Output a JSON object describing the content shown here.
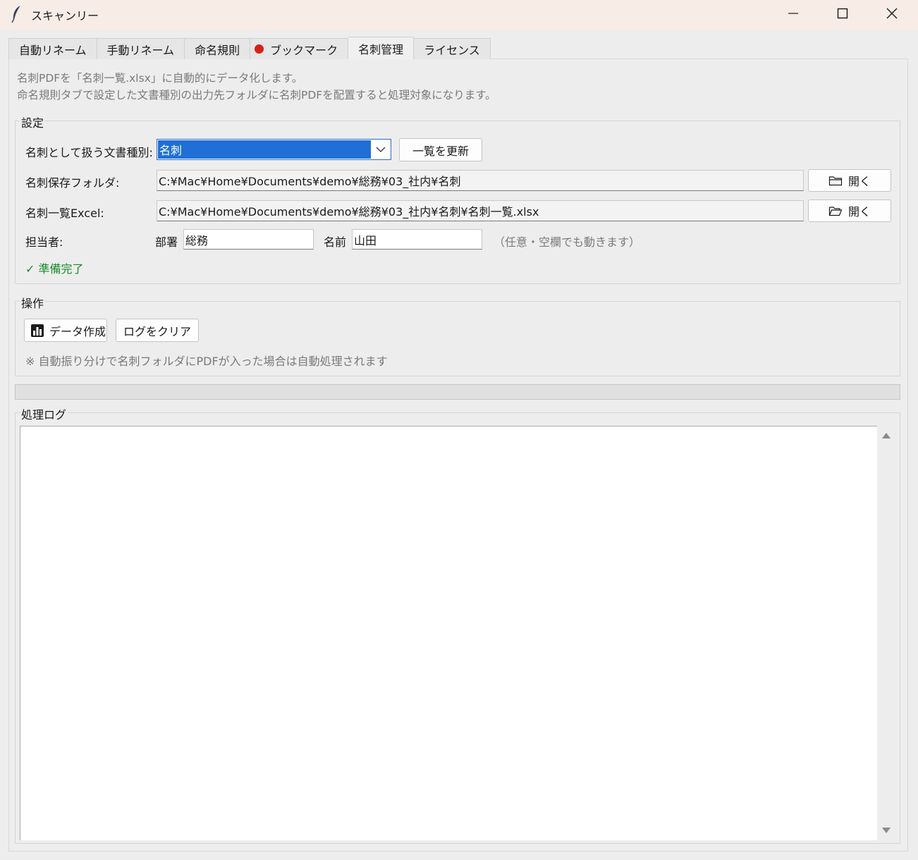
{
  "window": {
    "title": "スキャンリー",
    "controls": [
      "minimize",
      "maximize",
      "close"
    ]
  },
  "tabs": [
    {
      "label": "自動リネーム",
      "active": false
    },
    {
      "label": "手動リネーム",
      "active": false
    },
    {
      "label": "命名規則",
      "active": false
    },
    {
      "label": "ブックマーク",
      "active": false,
      "dot_color": "#d8201a"
    },
    {
      "label": "名刺管理",
      "active": true
    },
    {
      "label": "ライセンス",
      "active": false
    }
  ],
  "description": {
    "line1": "名刺PDFを「名刺一覧.xlsx」に自動的にデータ化します。",
    "line2": "命名規則タブで設定した文書種別の出力先フォルダに名刺PDFを配置すると処理対象になります。"
  },
  "settings": {
    "group_label": "設定",
    "doc_type_label": "名刺として扱う文書種別:",
    "doc_type_value": "名刺",
    "refresh_button": "一覧を更新",
    "folder_label": "名刺保存フォルダ:",
    "folder_value": "C:¥Mac¥Home¥Documents¥demo¥総務¥03_社内¥名刺",
    "excel_label": "名刺一覧Excel:",
    "excel_value": "C:¥Mac¥Home¥Documents¥demo¥総務¥03_社内¥名刺¥名刺一覧.xlsx",
    "open_button": "開く",
    "person_label": "担当者:",
    "dept_label": "部署",
    "dept_value": "総務",
    "name_label": "名前",
    "name_value": "山田",
    "optional_note": "（任意・空欄でも動きます）",
    "status_text": "✓ 準備完了",
    "status_color": "#1a8a2a"
  },
  "operations": {
    "group_label": "操作",
    "create_button": "データ作成",
    "clear_button": "ログをクリア",
    "note": "※ 自動振り分けで名刺フォルダにPDFが入った場合は自動処理されます"
  },
  "log": {
    "group_label": "処理ログ",
    "content": ""
  },
  "colors": {
    "accent": "#1f6fd6",
    "titlebar": "#f7ece6",
    "background": "#ededed"
  }
}
